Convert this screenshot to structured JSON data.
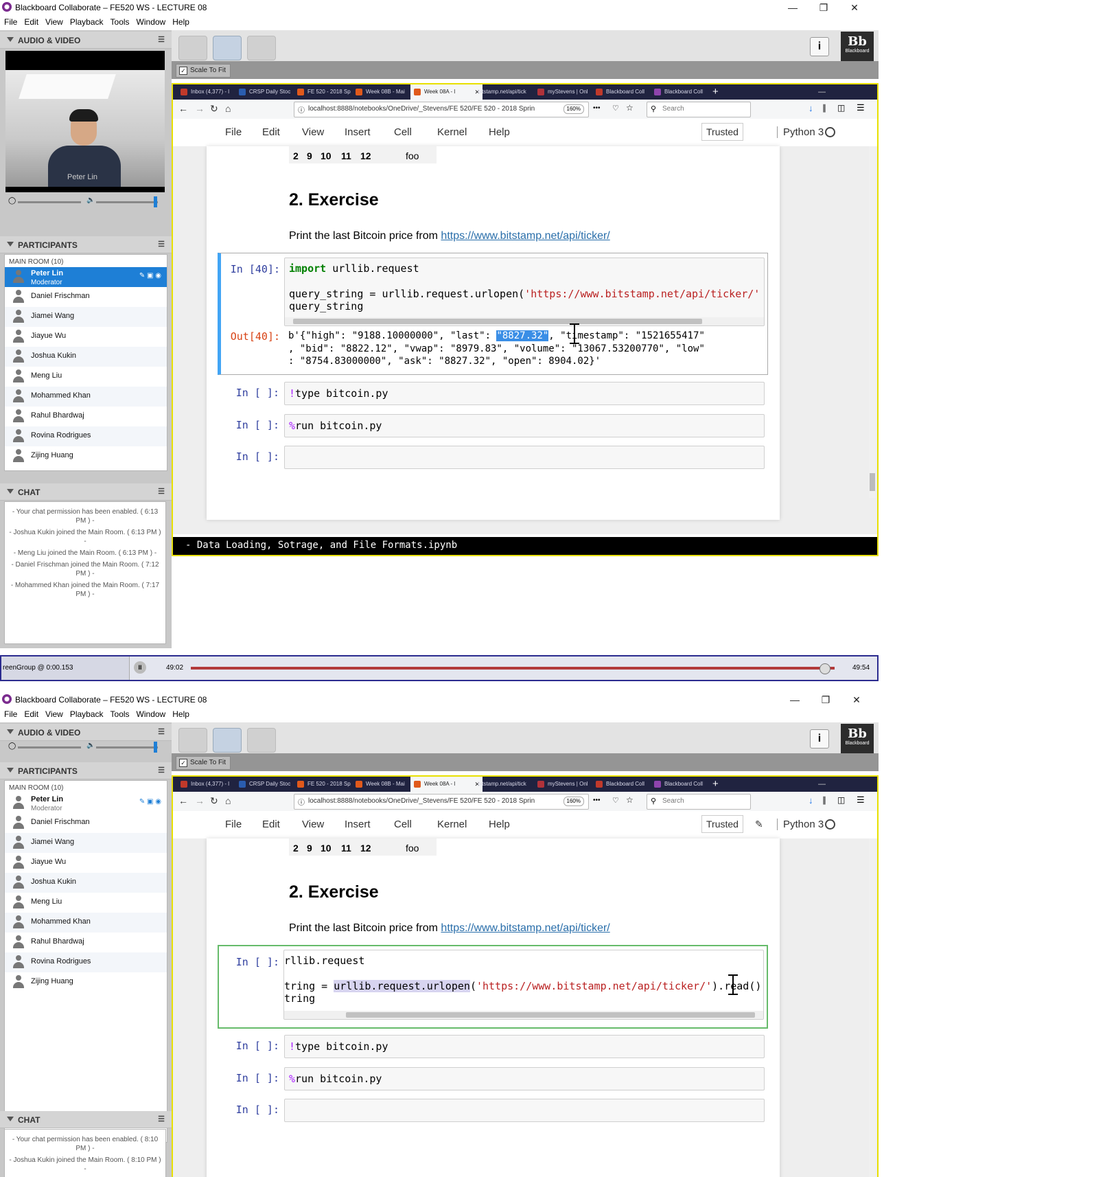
{
  "app": {
    "title": "Blackboard Collaborate – FE520 WS - LECTURE 08",
    "menu": [
      "File",
      "Edit",
      "View",
      "Playback",
      "Tools",
      "Window",
      "Help"
    ]
  },
  "left": {
    "audio_video": "AUDIO & VIDEO",
    "video_name": "Peter Lin",
    "participants_header": "PARTICIPANTS",
    "room": "MAIN ROOM",
    "room_count": "(10)",
    "participants": [
      {
        "name": "Peter Lin",
        "role": "Moderator"
      },
      {
        "name": "Daniel Frischman"
      },
      {
        "name": "Jiamei Wang"
      },
      {
        "name": "Jiayue Wu"
      },
      {
        "name": "Joshua Kukin"
      },
      {
        "name": "Meng Liu"
      },
      {
        "name": "Mohammed Khan"
      },
      {
        "name": "Rahul Bhardwaj"
      },
      {
        "name": "Rovina Rodrigues"
      },
      {
        "name": "Zijing Huang"
      }
    ],
    "chat_header": "CHAT",
    "chat1": [
      "- Your chat permission has been enabled. ( 6:13 PM ) -",
      "- Joshua Kukin joined the Main Room. ( 6:13 PM ) -",
      "- Meng Liu joined the Main Room. ( 6:13 PM ) -",
      "- Daniel Frischman joined the Main Room. ( 7:12 PM ) -",
      "- Mohammed Khan joined the Main Room. ( 7:17 PM ) -"
    ],
    "chat2": [
      "- Your chat permission has been enabled. ( 8:10 PM ) -",
      "- Joshua Kukin joined the Main Room. ( 8:10 PM ) -"
    ]
  },
  "toolbar": {
    "scale_to_fit": "Scale To Fit",
    "bb_logo": "Bb",
    "bb_sub": "Blackboard",
    "info": "i"
  },
  "browser": {
    "tabs": [
      "Inbox (4,377) - l",
      "CRSP Daily Stoc",
      "FE 520 - 2018 Sp",
      "Week 08B - Mai",
      "Week 08A - l",
      "bitstamp.net/api/tick",
      "myStevens | Onl",
      "Blackboard Coll",
      "Blackboard Coll"
    ],
    "tab_colors": [
      "#c0392b",
      "#2a5db0",
      "#e0591b",
      "#e0591b",
      "#e0591b",
      "#ffffff",
      "#b0323a",
      "#c0392b",
      "#8e44ad"
    ],
    "url": "localhost:8888/notebooks/OneDrive/_Stevens/FE 520/FE 520 - 2018 Sprin",
    "zoom": "160%",
    "search_placeholder": "Search",
    "new_tab": "+",
    "more": "•••"
  },
  "jupyter": {
    "menu": [
      "File",
      "Edit",
      "View",
      "Insert",
      "Cell",
      "Kernel",
      "Help"
    ],
    "trusted": "Trusted",
    "kernel": "Python 3",
    "table_row": [
      "2",
      "9",
      "10",
      "11",
      "12",
      "foo"
    ],
    "heading": "2. Exercise",
    "para_text": "Print the last Bitcoin price from ",
    "para_link": "https://www.bitstamp.net/api/ticker/",
    "cell1": {
      "prompt": "In [40]:",
      "l1_kw": "import",
      "l1_rest": " urllib.request",
      "l2_pre": "query_string = urllib.request.urlopen(",
      "l2_str": "'https://www.bitstamp.net/api/ticker/'",
      "l3": "query_string",
      "out_prompt": "Out[40]:",
      "out1_pre": "b'{\"high\": \"9188.10000000\", \"last\": ",
      "out1_hl": "\"8827.32\"",
      "out1_post": ", \"timestamp\": \"1521655417\"",
      "out2": ", \"bid\": \"8822.12\", \"vwap\": \"8979.83\", \"volume\": \"13067.53200770\", \"low\"",
      "out3": ": \"8754.83000000\", \"ask\": \"8827.32\", \"open\": 8904.02}'"
    },
    "cell2": {
      "prompt": "In [ ]:",
      "magic": "!",
      "rest": "type bitcoin.py"
    },
    "cell3": {
      "prompt": "In [ ]:",
      "magic": "%",
      "rest": "run bitcoin.py"
    },
    "cell4": {
      "prompt": "In [ ]:"
    },
    "bottom_cell": {
      "prompt": "In [ ]:",
      "l1": "rllib.request",
      "l2_pre": "tring = ",
      "l2_sel": "urllib.request.urlopen",
      "l2_mid": "(",
      "l2_str": "'https://www.bitstamp.net/api/ticker/'",
      "l2_post": ").read()",
      "l3": "tring"
    },
    "terminal": "- Data Loading, Sotrage, and File Formats.ipynb"
  },
  "playback": {
    "label": "reenGroup @ 0:00.153",
    "elapsed": "49:02",
    "total": "49:54",
    "progress": 0.985
  }
}
